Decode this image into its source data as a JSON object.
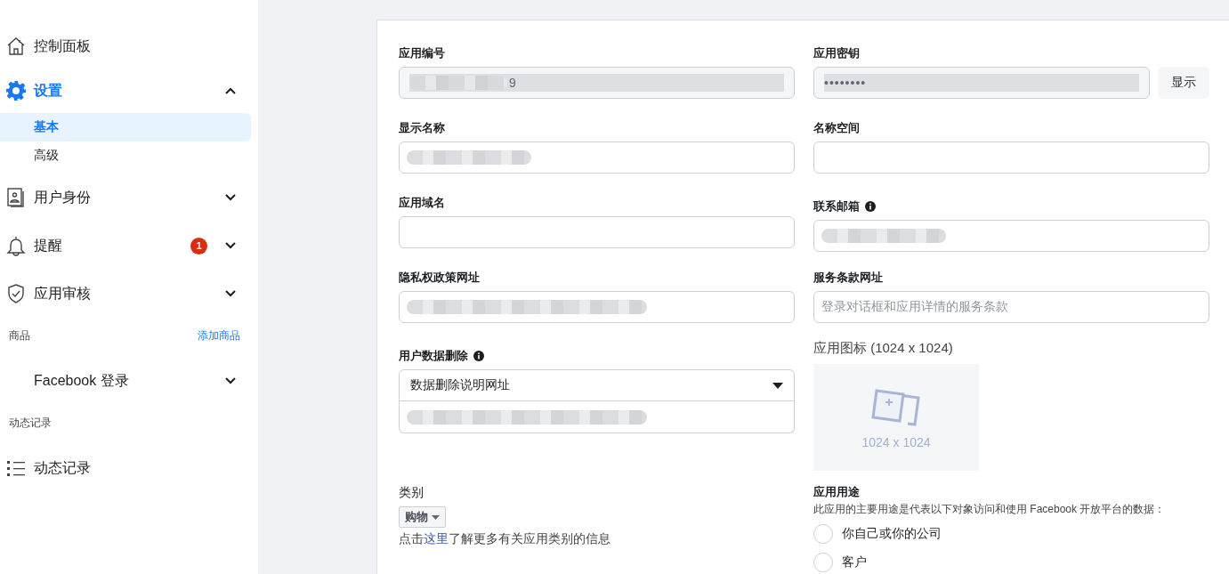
{
  "sidebar": [
    {
      "kind": "nav",
      "label": "控制面板",
      "selected": false
    },
    {
      "kind": "nav",
      "label": "设置",
      "selected": true,
      "expanded": true,
      "children": [
        {
          "label": "基本",
          "selected": true
        },
        {
          "label": "高级",
          "selected": false
        }
      ]
    },
    {
      "kind": "nav",
      "label": "用户身份",
      "selected": false,
      "expanded": false
    },
    {
      "kind": "nav",
      "label": "提醒",
      "selected": false,
      "expanded": false,
      "badge": "1"
    },
    {
      "kind": "nav",
      "label": "应用审核",
      "selected": false,
      "expanded": false
    },
    {
      "kind": "section",
      "label": "商品",
      "action": "添加商品"
    },
    {
      "kind": "nav",
      "label": "Facebook 登录",
      "selected": false,
      "expanded": false
    },
    {
      "kind": "section",
      "label": "动态记录"
    },
    {
      "kind": "nav",
      "label": "动态记录",
      "selected": false
    }
  ],
  "form": {
    "left": [
      {
        "kind": "readonly",
        "label": "应用编号",
        "redacted": true,
        "value": "9"
      },
      {
        "kind": "text",
        "label": "显示名称",
        "redacted": true
      },
      {
        "kind": "text",
        "label": "应用域名"
      },
      {
        "kind": "text",
        "label": "隐私权政策网址",
        "redacted": true
      },
      {
        "kind": "select",
        "label": "用户数据删除",
        "info": true,
        "option": "数据删除说明网址",
        "redacted": true
      },
      {
        "kind": "category",
        "label": "类别",
        "value": "购物",
        "help_before": "点击",
        "help_link": "这里",
        "help_after": "了解更多有关应用类别的信息"
      }
    ],
    "right": [
      {
        "kind": "secret",
        "label": "应用密钥",
        "value": "••••••••",
        "button": "显示"
      },
      {
        "kind": "text",
        "label": "名称空间"
      },
      {
        "kind": "text",
        "label": "联系邮箱",
        "info": true,
        "redacted": true
      },
      {
        "kind": "text",
        "label": "服务条款网址",
        "placeholder": "登录对话框和应用详情的服务条款"
      },
      {
        "kind": "icon_upload",
        "label": "应用图标 (1024 x 1024)",
        "caption": "1024 x 1024"
      },
      {
        "kind": "radio_group",
        "label": "应用用途",
        "description": "此应用的主要用途是代表以下对象访问和使用 Facebook 开放平台的数据：",
        "options": [
          {
            "label": "你自己或你的公司",
            "selected": false
          },
          {
            "label": "客户",
            "selected": false
          }
        ]
      }
    ]
  }
}
